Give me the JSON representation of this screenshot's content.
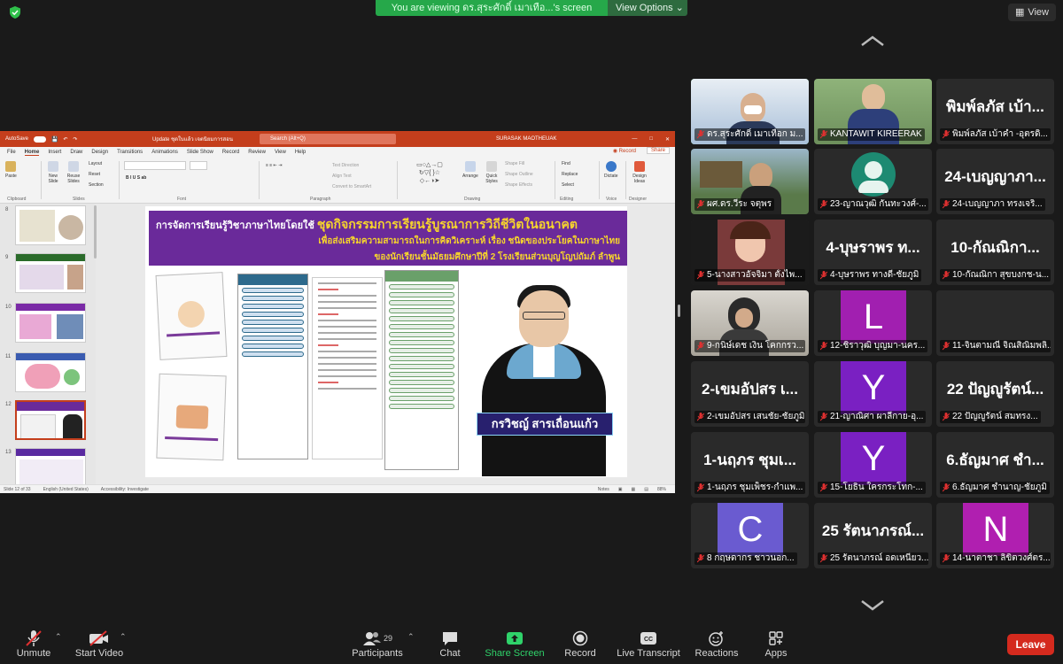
{
  "top": {
    "viewing_text": "You are viewing ดร.สุระศักดิ์ เมาเทือ...'s screen",
    "view_options": "View Options",
    "view_button": "View",
    "accent": "#26a84a"
  },
  "ppt": {
    "autosave": "AutoSave",
    "doc_name": "Update ชุดใบแล้ว เจตนิยมการสอน",
    "search": "Search (Alt+Q)",
    "user": "SURASAK MAOTHEUAK",
    "menu": [
      "File",
      "Home",
      "Insert",
      "Draw",
      "Design",
      "Transitions",
      "Animations",
      "Slide Show",
      "Record",
      "Review",
      "View",
      "Help"
    ],
    "record_btn": "Record",
    "share_btn": "Share",
    "ribbon_groups": [
      "Clipboard",
      "Slides",
      "Font",
      "Paragraph",
      "Drawing",
      "Editing",
      "Voice",
      "Designer"
    ],
    "ribbon_buttons": {
      "paste": "Paste",
      "new_slide": "New Slide",
      "reuse_slides": "Reuse Slides",
      "layout": "Layout",
      "reset": "Reset",
      "section": "Section",
      "text_direction": "Text Direction",
      "align_text": "Align Text",
      "convert_smartart": "Convert to SmartArt",
      "arrange": "Arrange",
      "quick_styles": "Quick Styles",
      "shape_fill": "Shape Fill",
      "shape_outline": "Shape Outline",
      "shape_effects": "Shape Effects",
      "find": "Find",
      "replace": "Replace",
      "select": "Select",
      "dictate": "Dictate",
      "design_ideas": "Design Ideas"
    },
    "thumbs": [
      {
        "num": "8",
        "selected": false
      },
      {
        "num": "9",
        "selected": false
      },
      {
        "num": "10",
        "selected": false
      },
      {
        "num": "11",
        "selected": false
      },
      {
        "num": "12",
        "selected": true
      },
      {
        "num": "13",
        "selected": false
      }
    ],
    "slide": {
      "line1_prefix": "การจัดการเรียนรู้วิชาภาษาไทยโดยใช้",
      "line1_highlight": "ชุดกิจกรรมการเรียนรู้บูรณาการวิถีชีวิตในอนาคต",
      "line2": "เพื่อส่งเสริมความสามารถในการคิดวิเคราะห์ เรื่อง ชนิดของประโยคในภาษาไทย",
      "line3": "ของนักเรียนชั้นมัธยมศึกษาปีที่ 2 โรงเรียนส่วนบุญโญปถัมภ์ ลำพูน",
      "presenter_name": "กรวิชญ์ สารเถื่อนแก้ว"
    },
    "status_left": "Slide 12 of 33",
    "status_lang": "English (United States)",
    "status_access": "Accessibility: Investigate",
    "status_notes": "Notes",
    "status_zoom": "88%"
  },
  "participants": [
    {
      "big": "",
      "label": "ดร.สุระศักดิ์ เมาเทือก ม...",
      "type": "video",
      "active": true
    },
    {
      "big": "",
      "label": "KANTAWIT KIREERAK",
      "type": "video",
      "active": false
    },
    {
      "big": "พิมพ์ลภัส เบ้า...",
      "label": "พิมพ์ลภัส เบ้าคำ -อุตรดิ...",
      "type": "name",
      "active": false
    },
    {
      "big": "",
      "label": "ผศ.ดร.วีระ จตุพร",
      "type": "video",
      "active": false
    },
    {
      "big": "",
      "label": "23-ญาณวุฒิ กันทะวงศ์-...",
      "type": "avatar-gray",
      "active": false
    },
    {
      "big": "24-เบญญาภา...",
      "label": "24-เบญญาภา ทรงเจริ...",
      "type": "name",
      "active": false
    },
    {
      "big": "",
      "label": "5-นางสาวอัจจิมา ตั้งไพ...",
      "type": "video",
      "active": false
    },
    {
      "big": "4-บุษราพร ท...",
      "label": "4-บุษราพร ทางดี-ชัยภูมิ",
      "type": "name",
      "active": false
    },
    {
      "big": "10-กัณณิกา...",
      "label": "10-กัณณิกา สุขบงกช-น...",
      "type": "name",
      "active": false
    },
    {
      "big": "",
      "label": "9-กนิษ์เดช เงิน โคกกรว...",
      "type": "video",
      "active": false
    },
    {
      "big": "L",
      "label": "12-ชิราวุฒิ บุญมา-นคร...",
      "type": "letter",
      "color": "#a11fb0",
      "active": false
    },
    {
      "big": "",
      "label": "11-จินตามณี จิณสิณิมพลิ...",
      "type": "blank",
      "active": false
    },
    {
      "big": "2-เขมอัปสร เ...",
      "label": "2-เขมอัปสร เสนชัย-ชัยภูมิ",
      "type": "name",
      "active": false
    },
    {
      "big": "Y",
      "label": "21-ญาณิศา ผาลีกาย-อุ...",
      "type": "letter",
      "color": "#7a20c2",
      "active": false
    },
    {
      "big": "22 ปัญญูรัตน์...",
      "label": "22 ปัญญูรัตน์ สมทรง...",
      "type": "name",
      "active": false
    },
    {
      "big": "1-นฤภร ชุมเ...",
      "label": "1-นฤภร ชุมเพ็ชร-กำแพ...",
      "type": "name",
      "active": false
    },
    {
      "big": "Y",
      "label": "15-โยธิน ใครกระโทก-...",
      "type": "letter",
      "color": "#7a20c2",
      "active": false
    },
    {
      "big": "6.ธัญมาศ ชำ...",
      "label": "6.ธัญมาศ ชำนาญ-ชัยภูมิ",
      "type": "name",
      "active": false
    },
    {
      "big": "C",
      "label": "8 กฤษดากร ชาวนอก...",
      "type": "letter",
      "color": "#6a5bd0",
      "active": false
    },
    {
      "big": "25 รัตนาภรณ์...",
      "label": "25 รัตนาภรณ์ อดเหนียว...",
      "type": "name",
      "active": false
    },
    {
      "big": "N",
      "label": "14-นาตาชา ลิขิตวงศ์ตร...",
      "type": "letter",
      "color": "#b01fb0",
      "active": false
    }
  ],
  "toolbar": {
    "unmute": "Unmute",
    "start_video": "Start Video",
    "participants": "Participants",
    "participants_count": "29",
    "chat": "Chat",
    "share_screen": "Share Screen",
    "record": "Record",
    "live_transcript": "Live Transcript",
    "reactions": "Reactions",
    "apps": "Apps",
    "leave": "Leave"
  }
}
